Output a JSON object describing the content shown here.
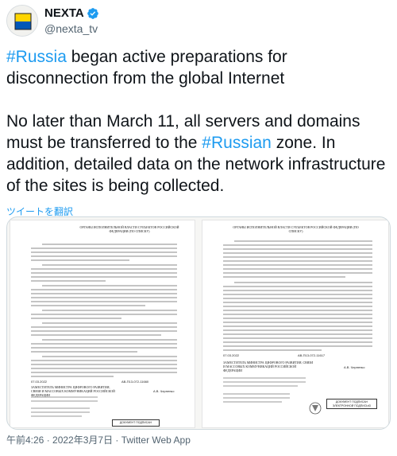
{
  "author": {
    "display_name": "NEXTA",
    "handle": "@nexta_tv",
    "verified": true,
    "avatar_colors": [
      "#f5c518",
      "#0057b8"
    ]
  },
  "tweet": {
    "paragraph1": {
      "hashtag": "#Russia",
      "text": " began active preparations for disconnection from the global Internet"
    },
    "paragraph2": {
      "text_before": "No later than March 11, all servers and domains must be transferred to the ",
      "hashtag": "#Russian",
      "text_after": " zone. In addition, detailed data on the network infrastructure of the sites is being collected."
    },
    "translate_link": "ツイートを翻訳"
  },
  "media": {
    "documents": [
      {
        "header": "ОРГАНЫ ИСПОЛНИТЕЛЬНОЙ ВЛАСТИ СУБЪЕКТОВ РОССИЙСКОЙ ФЕДЕРАЦИИ (ПО СПИСКУ)",
        "date": "07.03.2022",
        "number": "АВ-П13-072-11660",
        "signer": "А.В. Черненко",
        "signer_title": "ЗАМЕСТИТЕЛЬ МИНИСТРА ЦИФРОВОГО РАЗВИТИЯ, СВЯЗИ И МАССОВЫХ КОММУНИКАЦИЙ РОССИЙСКОЙ ФЕДЕРАЦИИ",
        "stamp": "ДОКУМЕНТ ПОДПИСАН"
      },
      {
        "header": "ОРГАНЫ ИСПОЛНИТЕЛЬНОЙ ВЛАСТИ СУБЪЕКТОВ РОССИЙСКОЙ ФЕДЕРАЦИИ (ПО СПИСКУ)",
        "date": "07.03.2022",
        "number": "АВ-П13-072-11617",
        "signer": "А.В. Черненко",
        "signer_title": "ЗАМЕСТИТЕЛЬ МИНИСТРА ЦИФРОВОГО РАЗВИТИЯ, СВЯЗИ И МАССОВЫХ КОММУНИКАЦИЙ РОССИЙСКОЙ ФЕДЕРАЦИИ",
        "stamp": "ДОКУМЕНТ ПОДПИСАН ЭЛЕКТРОННОЙ ПОДПИСЬЮ"
      }
    ]
  },
  "meta": {
    "timestamp": "午前4:26 · 2022年3月7日 · Twitter Web App"
  },
  "colors": {
    "link": "#1d9bf0",
    "text": "#0f1419",
    "secondary": "#536471",
    "verified": "#1d9bf0"
  }
}
